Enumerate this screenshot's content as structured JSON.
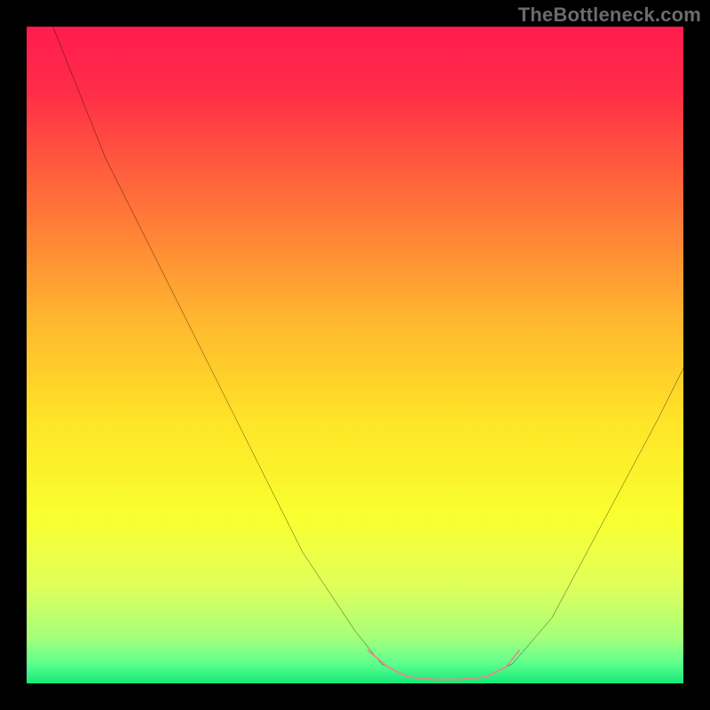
{
  "watermark": "TheBottleneck.com",
  "chart_data": {
    "type": "line",
    "title": "",
    "xlabel": "",
    "ylabel": "",
    "xlim": [
      0,
      100
    ],
    "ylim": [
      0,
      100
    ],
    "grid": false,
    "legend": false,
    "background_gradient_stops": [
      {
        "offset": 0,
        "color": "#ff1c4f"
      },
      {
        "offset": 0.1,
        "color": "#ff2d47"
      },
      {
        "offset": 0.25,
        "color": "#ff6a3a"
      },
      {
        "offset": 0.45,
        "color": "#ffb82f"
      },
      {
        "offset": 0.6,
        "color": "#ffe427"
      },
      {
        "offset": 0.75,
        "color": "#f9ff30"
      },
      {
        "offset": 0.85,
        "color": "#e0ff5a"
      },
      {
        "offset": 0.93,
        "color": "#a6ff7a"
      },
      {
        "offset": 0.97,
        "color": "#5dff8e"
      },
      {
        "offset": 1.0,
        "color": "#15e97a"
      }
    ],
    "series": [
      {
        "name": "bottleneck-curve",
        "color": "#000000",
        "width": 2,
        "data": [
          {
            "x": 4,
            "y": 100
          },
          {
            "x": 12,
            "y": 80
          },
          {
            "x": 22,
            "y": 60
          },
          {
            "x": 32,
            "y": 40
          },
          {
            "x": 42,
            "y": 20
          },
          {
            "x": 50,
            "y": 8
          },
          {
            "x": 54,
            "y": 3
          },
          {
            "x": 58,
            "y": 1
          },
          {
            "x": 64,
            "y": 0.5
          },
          {
            "x": 70,
            "y": 1
          },
          {
            "x": 74,
            "y": 3
          },
          {
            "x": 80,
            "y": 10
          },
          {
            "x": 88,
            "y": 25
          },
          {
            "x": 96,
            "y": 40
          },
          {
            "x": 100,
            "y": 48
          }
        ]
      },
      {
        "name": "highlight-segment",
        "color": "#e98a88",
        "width": 12,
        "linecap": "round",
        "data": [
          {
            "x": 52,
            "y": 5
          },
          {
            "x": 55,
            "y": 2.5
          },
          {
            "x": 58,
            "y": 1
          },
          {
            "x": 62,
            "y": 0.6
          },
          {
            "x": 66,
            "y": 0.6
          },
          {
            "x": 70,
            "y": 1
          },
          {
            "x": 73,
            "y": 2.5
          },
          {
            "x": 75,
            "y": 5
          }
        ]
      }
    ]
  }
}
